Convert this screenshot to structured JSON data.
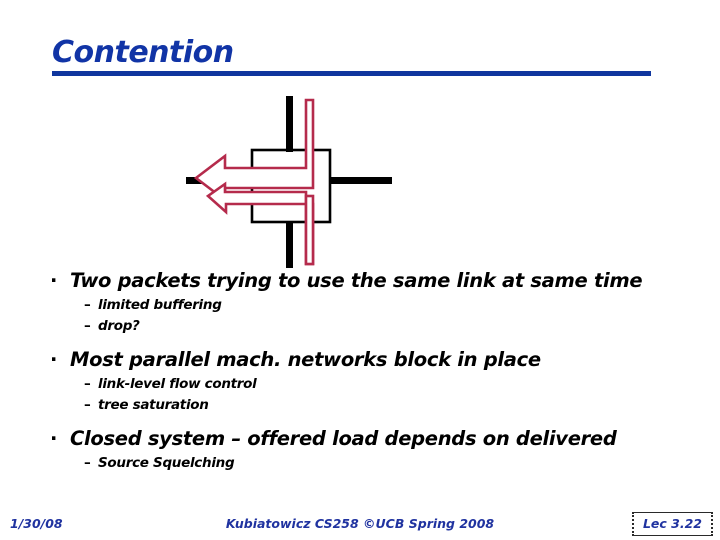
{
  "slide": {
    "title": "Contention",
    "title_color": "#1134A6",
    "rule_color": "#10369E"
  },
  "diagram": {
    "name": "router-contention-diagram",
    "description": "Switch node with two packet flows contending for the same outgoing left link",
    "node_color": "#000000",
    "packet_color": "#B52B4C",
    "elements": [
      "switch-box",
      "vertical-link",
      "horizontal-link",
      "packet-arrow-from-north",
      "packet-arrow-from-east"
    ]
  },
  "bullets": [
    {
      "marker": "·",
      "text": "Two packets trying to use the same link at same time",
      "sub": [
        {
          "marker": "–",
          "text": "limited buffering"
        },
        {
          "marker": "–",
          "text": "drop?"
        }
      ]
    },
    {
      "marker": "·",
      "text": "Most parallel mach. networks block in place",
      "sub": [
        {
          "marker": "–",
          "text": "link-level flow control"
        },
        {
          "marker": "–",
          "text": "tree saturation"
        }
      ]
    },
    {
      "marker": "·",
      "text": "Closed system – offered load depends on delivered",
      "sub": [
        {
          "marker": "–",
          "text": "Source Squelching"
        }
      ]
    }
  ],
  "footer": {
    "date": "1/30/08",
    "center": "Kubiatowicz CS258 ©UCB Spring 2008",
    "lecture": "Lec 3.22",
    "color": "#2033A0"
  }
}
